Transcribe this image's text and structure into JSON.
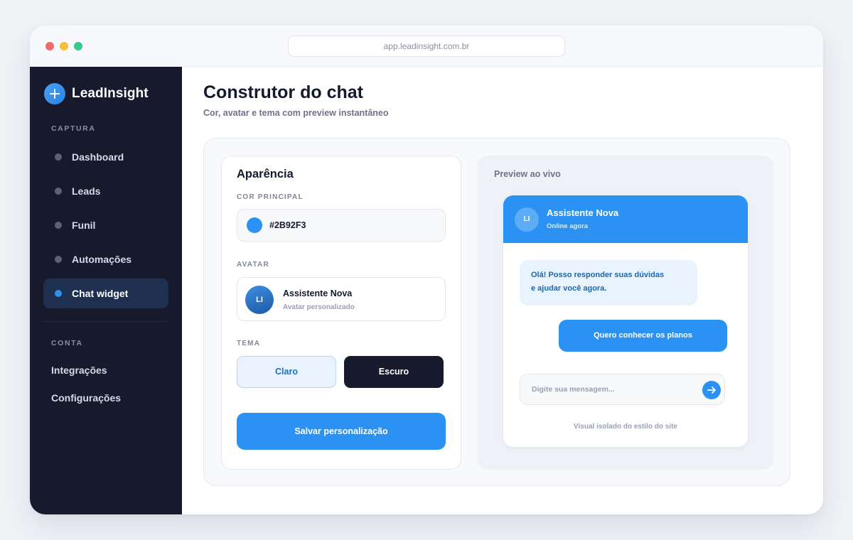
{
  "browser": {
    "url": "app.leadinsight.com.br"
  },
  "sidebar": {
    "brand": "LeadInsight",
    "section_capture": "CAPTURA",
    "items": [
      {
        "label": "Dashboard"
      },
      {
        "label": "Leads"
      },
      {
        "label": "Funil"
      },
      {
        "label": "Automações"
      },
      {
        "label": "Chat widget",
        "active": true
      }
    ],
    "section_account": "CONTA",
    "account_items": [
      {
        "label": "Integrações"
      },
      {
        "label": "Configurações"
      }
    ]
  },
  "page": {
    "title": "Construtor do chat",
    "subtitle": "Cor, avatar e tema com preview instantâneo"
  },
  "appearance": {
    "title": "Aparência",
    "color_label": "COR PRINCIPAL",
    "color_value": "#2B92F3",
    "avatar_label": "AVATAR",
    "avatar_initials": "LI",
    "avatar_name": "Assistente Nova",
    "avatar_desc": "Avatar personalizado",
    "theme_label": "TEMA",
    "theme_light": "Claro",
    "theme_dark": "Escuro",
    "save_label": "Salvar personalização"
  },
  "preview": {
    "label": "Preview ao vivo",
    "avatar_initials": "LI",
    "assistant_name": "Assistente Nova",
    "status": "Online agora",
    "bot_message_line1": "Olá! Posso responder suas dúvidas",
    "bot_message_line2": "e ajudar você agora.",
    "user_reply": "Quero conhecer os planos",
    "input_placeholder": "Digite sua mensagem...",
    "footer": "Visual isolado do estilo do site"
  },
  "colors": {
    "accent": "#2B92F3",
    "sidebar_bg": "#171A2D",
    "close": "#EF6B6B",
    "minimize": "#F3BF3C",
    "maximize": "#35C98B"
  }
}
